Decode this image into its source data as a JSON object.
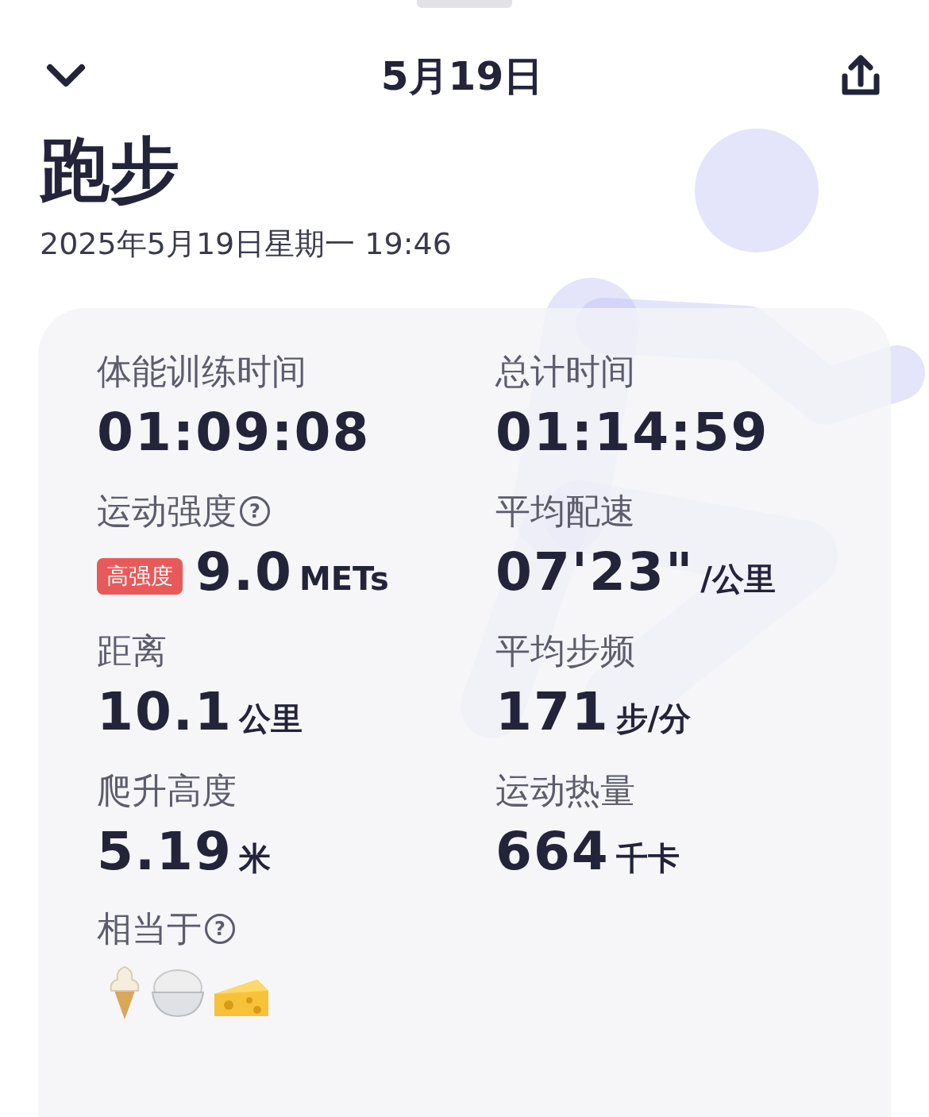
{
  "header": {
    "title": "5月19日"
  },
  "workout": {
    "title": "跑步",
    "datetime": "2025年5月19日星期一 19:46"
  },
  "metrics": [
    {
      "label": "体能训练时间",
      "value": "01:09:08"
    },
    {
      "label": "总计时间",
      "value": "01:14:59"
    },
    {
      "label": "运动强度",
      "help": "?",
      "badge": "高强度",
      "value": "9.0",
      "unit": "METs"
    },
    {
      "label": "平均配速",
      "value": "07'23\"",
      "unit": "/公里"
    },
    {
      "label": "距离",
      "value": "10.1",
      "unit": "公里"
    },
    {
      "label": "平均步频",
      "value": "171",
      "unit": "步/分"
    },
    {
      "label": "爬升高度",
      "value": "5.19",
      "unit": "米"
    },
    {
      "label": "运动热量",
      "value": "664",
      "unit": "千卡"
    }
  ],
  "equivalent": {
    "label": "相当于",
    "help": "?"
  }
}
